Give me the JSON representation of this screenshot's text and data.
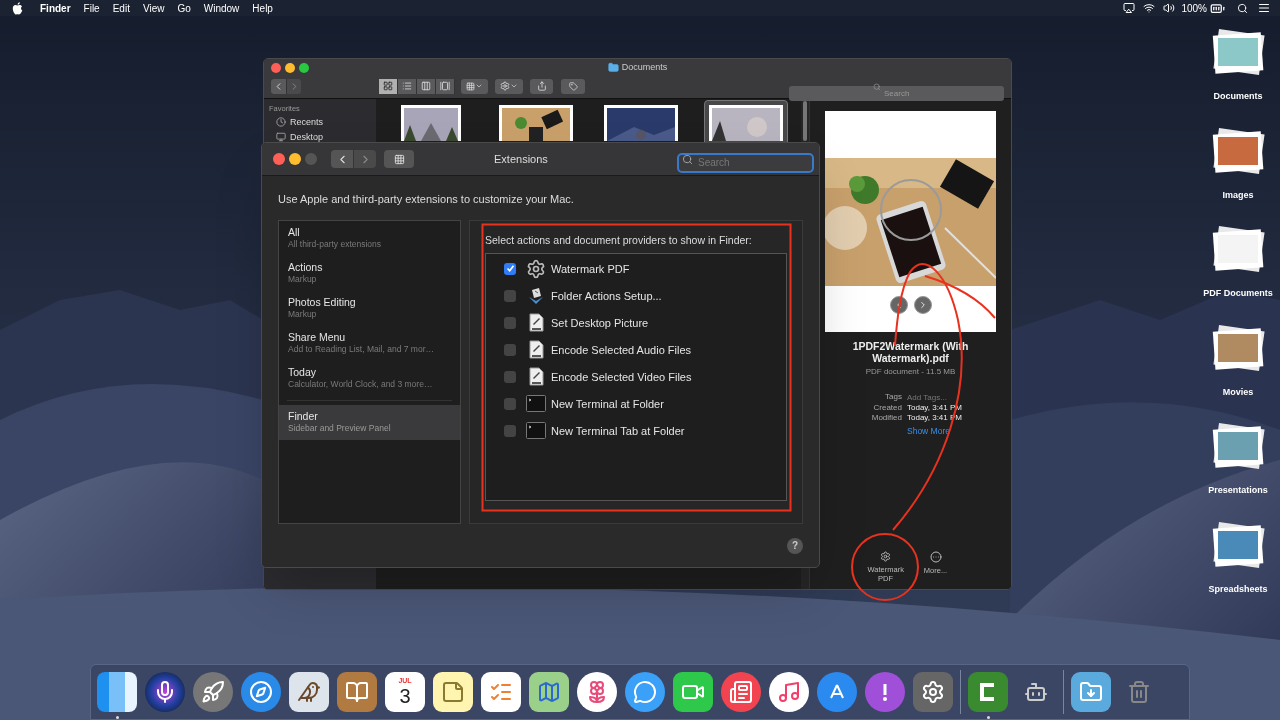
{
  "menu_bar": {
    "app_name": "Finder",
    "menus": [
      "File",
      "Edit",
      "View",
      "Go",
      "Window",
      "Help"
    ],
    "battery": "100%"
  },
  "finder_window": {
    "title": "Documents",
    "view_modes": [
      {
        "kind": "icons",
        "selected": true
      },
      {
        "kind": "list",
        "selected": false
      },
      {
        "kind": "columns",
        "selected": false
      },
      {
        "kind": "gallery",
        "selected": false
      }
    ],
    "search_placeholder": "Search",
    "sidebar": {
      "heading": "Favorites",
      "items": [
        {
          "label": "Recents",
          "kind": "recents"
        },
        {
          "label": "Desktop",
          "kind": "desktop"
        }
      ]
    },
    "files": [
      {
        "kind": "picture",
        "selected": false
      },
      {
        "kind": "picture",
        "selected": false
      },
      {
        "kind": "picture",
        "selected": false
      },
      {
        "kind": "picture",
        "selected": true
      }
    ],
    "preview": {
      "file_name": "1PDF2Watermark (With Watermark).pdf",
      "file_info": "PDF document - 11.5 MB",
      "metadata": [
        {
          "label": "Tags",
          "placeholder": "Add Tags..."
        },
        {
          "label": "Created",
          "value": "Today, 3:41 PM"
        },
        {
          "label": "Modified",
          "value": "Today, 3:41 PM"
        }
      ],
      "show_more": "Show More",
      "quick_actions": [
        {
          "kind": "gear",
          "label": "Watermark PDF"
        },
        {
          "kind": "more",
          "label": "More..."
        }
      ]
    }
  },
  "extensions_window": {
    "title": "Extensions",
    "search_placeholder": "Search",
    "description": "Use Apple and third-party extensions to customize your Mac.",
    "categories": [
      {
        "name": "All",
        "subtitle": "All third-party extensions",
        "selected": false
      },
      {
        "name": "Actions",
        "subtitle": "Markup",
        "selected": false
      },
      {
        "name": "Photos Editing",
        "subtitle": "Markup",
        "selected": false
      },
      {
        "name": "Share Menu",
        "subtitle": "Add to Reading List, Mail, and 7 mor…",
        "selected": false
      },
      {
        "name": "Today",
        "subtitle": "Calculator, World Clock, and 3 more…",
        "selected": false
      },
      {
        "name": "Finder",
        "subtitle": "Sidebar and Preview Panel",
        "selected": true
      }
    ],
    "list_heading": "Select actions and document providers to show in Finder:",
    "extensions": [
      {
        "name": "Watermark PDF",
        "kind": "gear",
        "checked": true
      },
      {
        "name": "Folder Actions Setup...",
        "kind": "folder_script",
        "checked": false
      },
      {
        "name": "Set Desktop Picture",
        "kind": "script",
        "checked": false
      },
      {
        "name": "Encode Selected Audio Files",
        "kind": "script",
        "checked": false
      },
      {
        "name": "Encode Selected Video Files",
        "kind": "script",
        "checked": false
      },
      {
        "name": "New Terminal at Folder",
        "kind": "terminal",
        "checked": false
      },
      {
        "name": "New Terminal Tab at Folder",
        "kind": "terminal",
        "checked": false
      }
    ],
    "help": "?"
  },
  "desktop_icons": [
    {
      "label": "Documents",
      "kind": "documents"
    },
    {
      "label": "Images",
      "kind": "images"
    },
    {
      "label": "PDF Documents",
      "kind": "pdf"
    },
    {
      "label": "Movies",
      "kind": "movies"
    },
    {
      "label": "Presentations",
      "kind": "presentations"
    },
    {
      "label": "Spreadsheets",
      "kind": "spreadsheets"
    }
  ],
  "dock": [
    {
      "kind": "finder",
      "running": true
    },
    {
      "kind": "siri",
      "running": false
    },
    {
      "kind": "launchpad",
      "running": false
    },
    {
      "kind": "safari",
      "running": false
    },
    {
      "kind": "mail",
      "running": false
    },
    {
      "kind": "contacts",
      "running": false
    },
    {
      "kind": "calendar",
      "month": "JUL",
      "day": "3",
      "running": false
    },
    {
      "kind": "notes",
      "running": false
    },
    {
      "kind": "reminders",
      "running": false
    },
    {
      "kind": "maps",
      "running": false
    },
    {
      "kind": "photos",
      "running": false
    },
    {
      "kind": "messages",
      "running": false
    },
    {
      "kind": "facetime",
      "running": false
    },
    {
      "kind": "news",
      "running": false
    },
    {
      "kind": "music",
      "running": false
    },
    {
      "kind": "appstore",
      "running": false
    },
    {
      "kind": "feedback",
      "running": false
    },
    {
      "kind": "preferences",
      "running": false
    },
    {
      "kind": "separator"
    },
    {
      "kind": "camtasia",
      "running": true
    },
    {
      "kind": "automator",
      "running": false
    },
    {
      "kind": "separator"
    },
    {
      "kind": "downloads",
      "running": false
    },
    {
      "kind": "trash",
      "running": false
    }
  ]
}
